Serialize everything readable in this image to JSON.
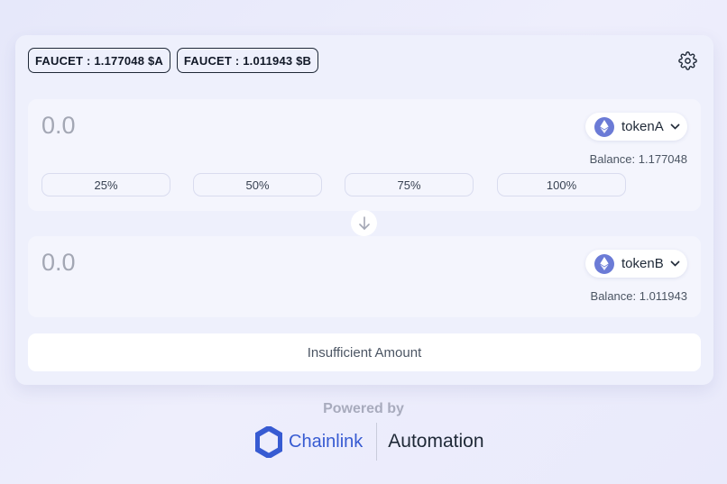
{
  "faucets": [
    {
      "label": "FAUCET : 1.177048 $A"
    },
    {
      "label": "FAUCET : 1.011943 $B"
    }
  ],
  "swap": {
    "from": {
      "amount_placeholder": "0.0",
      "token": "tokenA",
      "balance": "Balance: 1.177048",
      "percent_options": [
        "25%",
        "50%",
        "75%",
        "100%"
      ]
    },
    "to": {
      "amount_placeholder": "0.0",
      "token": "tokenB",
      "balance": "Balance: 1.011943"
    },
    "submit_label": "Insufficient Amount"
  },
  "footer": {
    "powered_by": "Powered by",
    "chainlink": "Chainlink",
    "automation": "Automation"
  },
  "colors": {
    "accent": "#375bd2",
    "eth_icon": "#6b7bd6",
    "background": "#e6e8fa"
  },
  "icons": [
    "gear-icon",
    "eth-icon",
    "chevron-down-icon",
    "arrow-down-icon",
    "chainlink-logo-icon"
  ]
}
